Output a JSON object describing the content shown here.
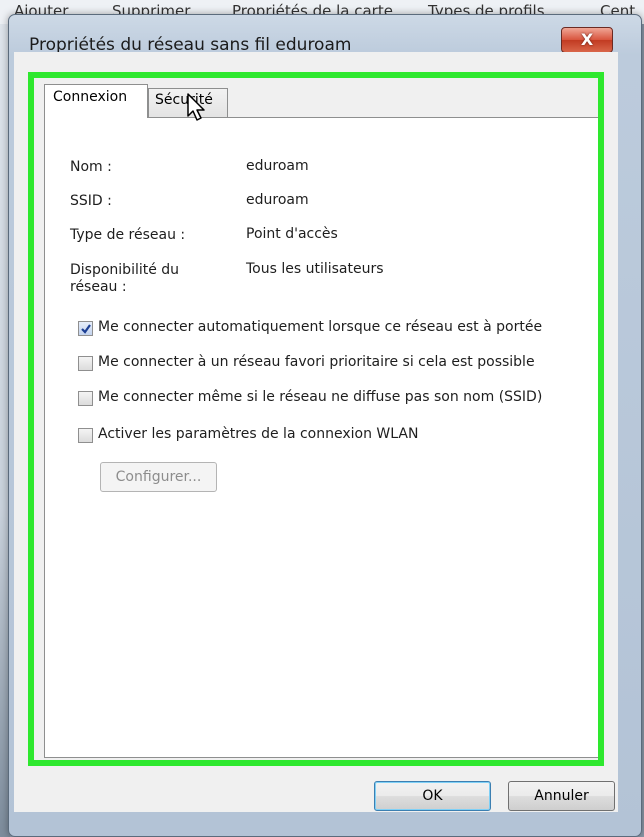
{
  "background_menu": {
    "items": [
      "Ajouter",
      "Supprimer",
      "Propriétés de la carte",
      "Types de profils",
      "Cent"
    ]
  },
  "dialog": {
    "title": "Propriétés du réseau sans fil eduroam",
    "close_label": "X",
    "tabs": [
      {
        "label": "Connexion",
        "active": true
      },
      {
        "label": "Sécurité",
        "active": false
      }
    ],
    "fields": [
      {
        "label": "Nom :",
        "value": "eduroam"
      },
      {
        "label": "SSID :",
        "value": "eduroam"
      },
      {
        "label": "Type de réseau :",
        "value": "Point d'accès"
      },
      {
        "label_line1": "Disponibilité du",
        "label_line2": "réseau :",
        "value": "Tous les utilisateurs"
      }
    ],
    "checkboxes": [
      {
        "label": "Me connecter automatiquement lorsque ce réseau est à portée",
        "checked": true
      },
      {
        "label": "Me connecter à un réseau favori prioritaire si cela est possible",
        "checked": false
      },
      {
        "label": "Me connecter même si le réseau ne diffuse pas son nom (SSID)",
        "checked": false
      },
      {
        "label": "Activer les paramètres de la connexion WLAN",
        "checked": false
      }
    ],
    "configure_label": "Configurer...",
    "configure_enabled": false,
    "ok_label": "OK",
    "cancel_label": "Annuler"
  },
  "colors": {
    "highlight_frame": "#2ee82e",
    "close_button": "#c23b22"
  },
  "icons": [
    "close-icon",
    "checkmark-icon",
    "mouse-cursor-icon"
  ]
}
